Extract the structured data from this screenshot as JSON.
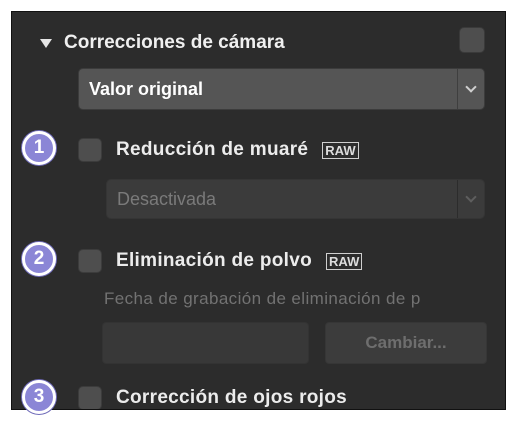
{
  "section": {
    "title": "Correcciones de cámara",
    "preset_select": {
      "value": "Valor original"
    }
  },
  "moire": {
    "label": "Reducción de muaré",
    "badge": "RAW",
    "select_value": "Desactivada",
    "checked": false
  },
  "dust": {
    "label": "Eliminación de polvo",
    "badge": "RAW",
    "info": "Fecha de grabación de eliminación de p",
    "change_button": "Cambiar...",
    "checked": false
  },
  "redeye": {
    "label": "Corrección de ojos rojos",
    "checked": false
  },
  "callouts": [
    "1",
    "2",
    "3"
  ],
  "colors": {
    "panel_bg": "#2c2c2c",
    "callout": "#8b86d6",
    "text": "#ececec",
    "disabled_text": "#727272"
  }
}
